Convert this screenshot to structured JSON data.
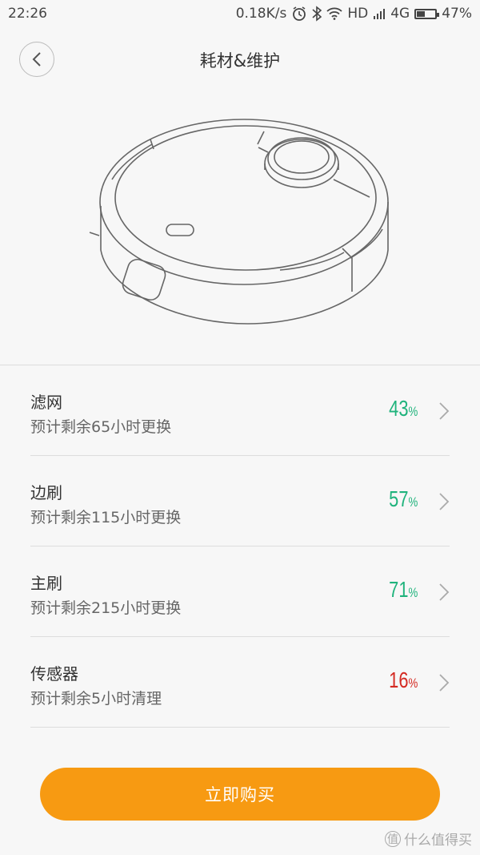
{
  "status_bar": {
    "time": "22:26",
    "net_speed": "0.18K/s",
    "hd": "HD",
    "network": "4G",
    "battery": "47%",
    "battery_level": 0.47
  },
  "header": {
    "title": "耗材&维护"
  },
  "items": [
    {
      "name": "滤网",
      "sub": "预计剩余65小时更换",
      "pct": "43",
      "unit": "%",
      "color": "#1fb37c"
    },
    {
      "name": "边刷",
      "sub": "预计剩余115小时更换",
      "pct": "57",
      "unit": "%",
      "color": "#1fb37c"
    },
    {
      "name": "主刷",
      "sub": "预计剩余215小时更换",
      "pct": "71",
      "unit": "%",
      "color": "#1fb37c"
    },
    {
      "name": "传感器",
      "sub": "预计剩余5小时清理",
      "pct": "16",
      "unit": "%",
      "color": "#d42a22"
    }
  ],
  "buy_button": {
    "label": "立即购买",
    "color": "#f79a12"
  },
  "watermark": {
    "text": "什么值得买",
    "icon_glyph": "值"
  }
}
